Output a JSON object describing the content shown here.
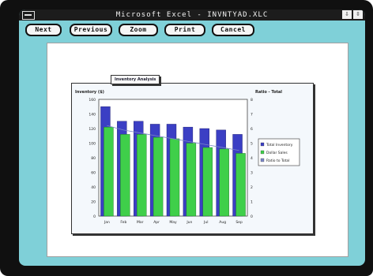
{
  "window": {
    "title": "Microsoft Excel - INVNTYAD.XLC",
    "minimize_glyph": "⇩",
    "restore_glyph": "⇳"
  },
  "toolbar": {
    "next_label": "Next",
    "previous_label": "Previous",
    "zoom_label": "Zoom",
    "print_label": "Print",
    "cancel_label": "Cancel"
  },
  "colors": {
    "desktop": "#7fd0d8",
    "bar_inventory": "#3b3fc4",
    "bar_sales": "#3fcf4a",
    "line_ratio": "#7a86c8"
  },
  "chart_data": {
    "type": "bar",
    "title": "Inventory Analysis",
    "ylabel_left": "Inventory ($)",
    "ylabel_right": "Ratio - Total",
    "categories": [
      "Jan",
      "Feb",
      "Mar",
      "Apr",
      "May",
      "Jun",
      "Jul",
      "Aug",
      "Sep"
    ],
    "series": [
      {
        "name": "Total Inventory",
        "values": [
          150,
          130,
          130,
          126,
          126,
          122,
          120,
          118,
          112
        ]
      },
      {
        "name": "Dollar Sales",
        "values": [
          122,
          112,
          112,
          108,
          106,
          100,
          94,
          92,
          86
        ]
      },
      {
        "name": "Ratio to Total",
        "axis": "right",
        "values": [
          6.2,
          5.9,
          5.7,
          5.5,
          5.3,
          5.1,
          4.9,
          4.7,
          4.5
        ]
      }
    ],
    "ylim_left": [
      0,
      160
    ],
    "ylim_right": [
      0,
      8
    ],
    "yticks_left": [
      "0",
      "20",
      "40",
      "60",
      "80",
      "100",
      "120",
      "140",
      "160"
    ],
    "yticks_right": [
      "0",
      "1",
      "2",
      "3",
      "4",
      "5",
      "6",
      "7",
      "8"
    ],
    "grid": false,
    "legend_position": "right"
  }
}
